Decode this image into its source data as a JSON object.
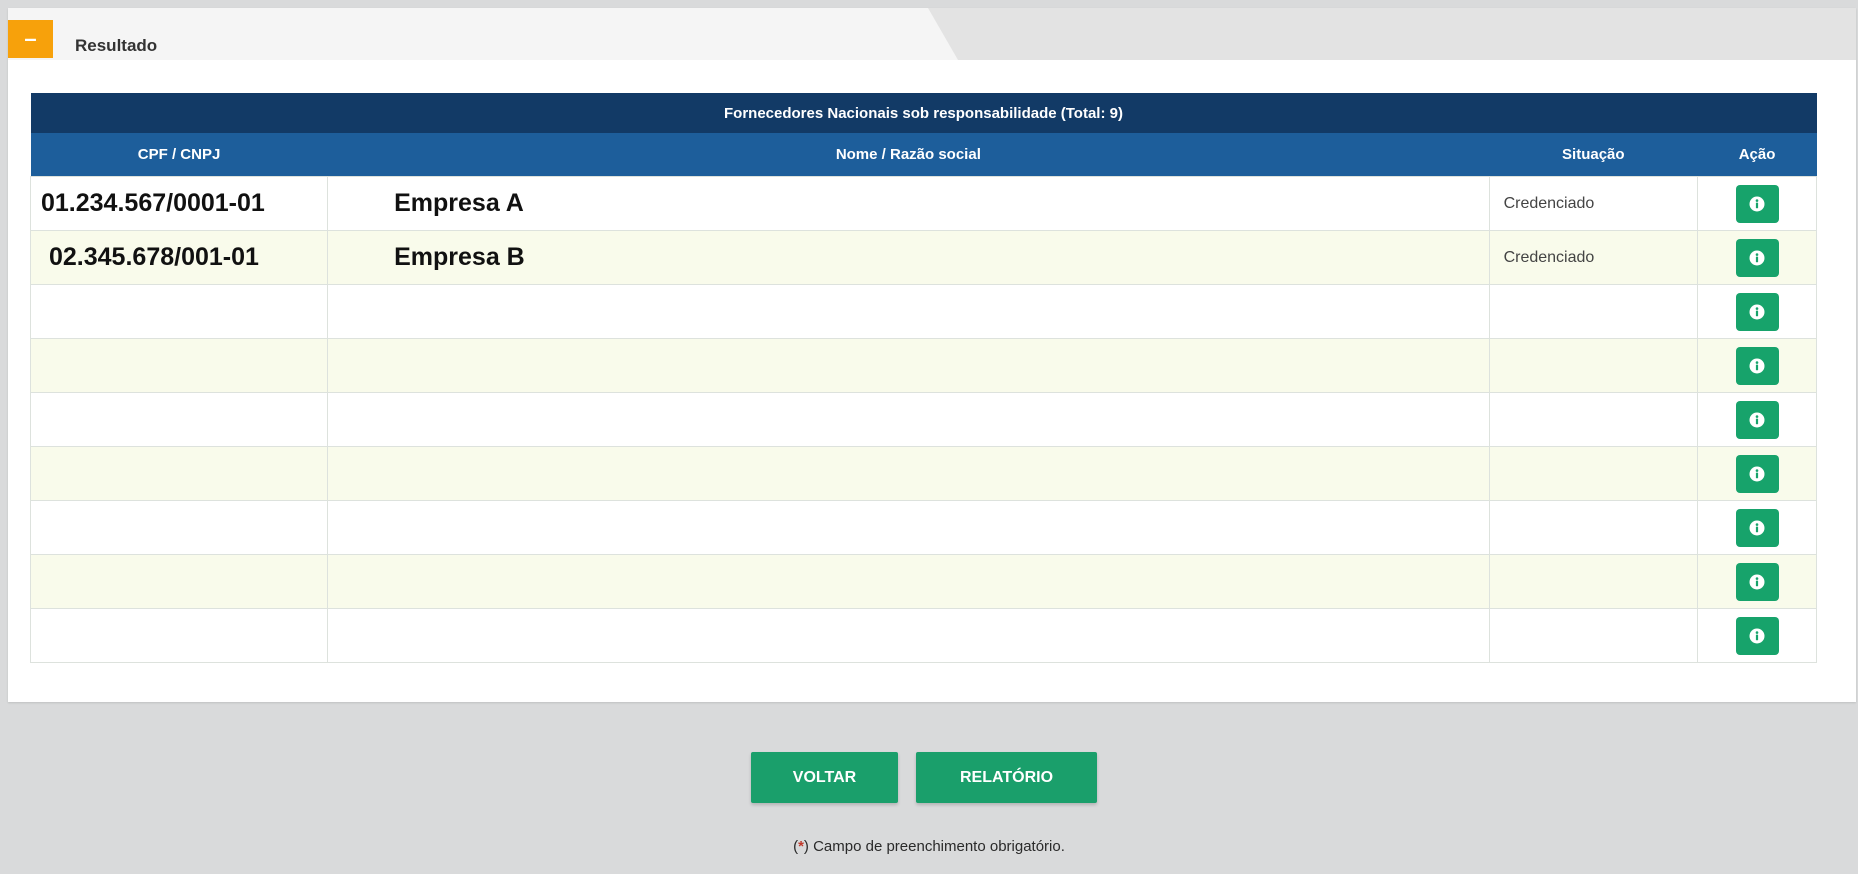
{
  "panel": {
    "toggle_symbol": "–",
    "title": "Resultado"
  },
  "table": {
    "caption": "Fornecedores Nacionais sob responsabilidade (Total: 9)",
    "columns": [
      "CPF / CNPJ",
      "Nome / Razão social",
      "Situação",
      "Ação"
    ],
    "rows": [
      {
        "cpf_cnpj": "01.234.567/0001-01",
        "nome": "Empresa A",
        "situacao": "Credenciado"
      },
      {
        "cpf_cnpj": "02.345.678/001-01",
        "nome": "Empresa B",
        "situacao": "Credenciado"
      },
      {
        "cpf_cnpj": "",
        "nome": "",
        "situacao": ""
      },
      {
        "cpf_cnpj": "",
        "nome": "",
        "situacao": ""
      },
      {
        "cpf_cnpj": "",
        "nome": "",
        "situacao": ""
      },
      {
        "cpf_cnpj": "",
        "nome": "",
        "situacao": ""
      },
      {
        "cpf_cnpj": "",
        "nome": "",
        "situacao": ""
      },
      {
        "cpf_cnpj": "",
        "nome": "",
        "situacao": ""
      },
      {
        "cpf_cnpj": "",
        "nome": "",
        "situacao": ""
      }
    ],
    "action_icon": "info-icon"
  },
  "buttons": {
    "voltar": "VOLTAR",
    "relatorio": "RELATÓRIO"
  },
  "footer": {
    "open_paren": "(",
    "required_star": "*",
    "note": ") Campo de preenchimento obrigatório."
  },
  "colors": {
    "accent_orange": "#f7a10b",
    "header_dark_blue": "#123a66",
    "header_blue": "#1d5e9b",
    "action_green": "#17a36b",
    "row_alt": "#f9fbeb"
  }
}
